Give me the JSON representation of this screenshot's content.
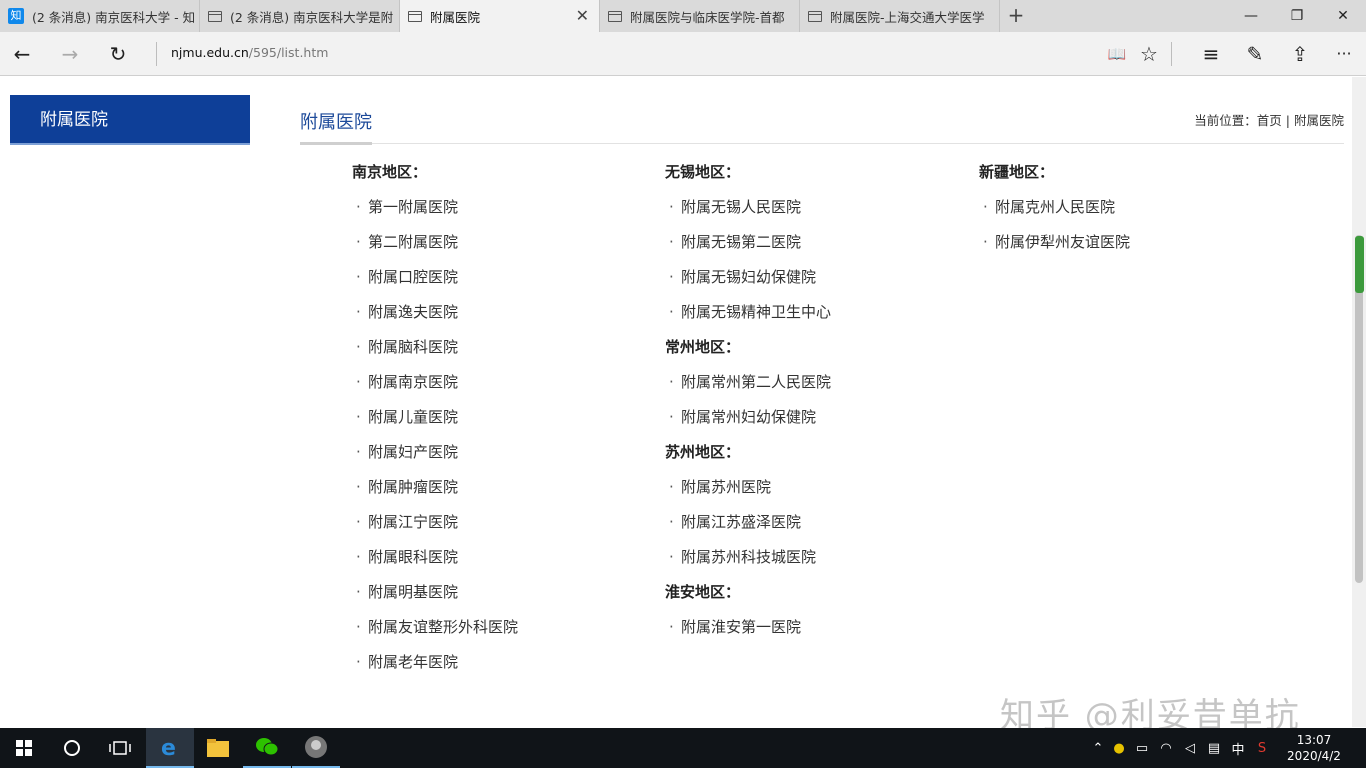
{
  "browser": {
    "tabs": [
      {
        "title": "(2 条消息) 南京医科大学 - 知",
        "icon": "zhihu-icon",
        "active": false
      },
      {
        "title": "(2 条消息) 南京医科大学是附",
        "icon": "page-icon",
        "active": false
      },
      {
        "title": "附属医院",
        "icon": "page-icon",
        "active": true
      },
      {
        "title": "附属医院与临床医学院-首都",
        "icon": "page-icon",
        "active": false
      },
      {
        "title": "附属医院-上海交通大学医学",
        "icon": "page-icon",
        "active": false
      }
    ],
    "zhihu_badge": "知",
    "new_tab": "+",
    "window_controls": {
      "minimize": "—",
      "restore": "❐",
      "close": "✕"
    },
    "tab_close": "✕",
    "address": {
      "host": "njmu.edu.cn",
      "path": "/595/list.htm"
    },
    "nav": {
      "back": "←",
      "forward": "→",
      "refresh": "↻"
    },
    "toolbar_icons": [
      "reading-view-icon",
      "favorite-star-icon",
      "hub-icon",
      "notes-icon",
      "share-icon",
      "more-icon"
    ],
    "toolbar_glyphs": {
      "reading": "📖",
      "star": "☆",
      "hub": "≡",
      "notes": "✎",
      "share": "⇪",
      "more": "···"
    }
  },
  "page": {
    "sidebar_title": "附属医院",
    "title": "附属医院",
    "breadcrumb": {
      "prefix": "当前位置：",
      "home": "首页",
      "sep": " | ",
      "current": "附属医院"
    },
    "bullet": "·",
    "columns": [
      [
        {
          "region": "南京地区：",
          "hospitals": [
            "第一附属医院",
            "第二附属医院",
            "附属口腔医院",
            "附属逸夫医院",
            "附属脑科医院",
            "附属南京医院",
            "附属儿童医院",
            "附属妇产医院",
            "附属肿瘤医院",
            "附属江宁医院",
            "附属眼科医院",
            "附属明基医院",
            "附属友谊整形外科医院",
            "附属老年医院"
          ]
        }
      ],
      [
        {
          "region": "无锡地区：",
          "hospitals": [
            "附属无锡人民医院",
            "附属无锡第二医院",
            "附属无锡妇幼保健院",
            "附属无锡精神卫生中心"
          ]
        },
        {
          "region": "常州地区：",
          "hospitals": [
            "附属常州第二人民医院",
            "附属常州妇幼保健院"
          ]
        },
        {
          "region": "苏州地区：",
          "hospitals": [
            "附属苏州医院",
            "附属江苏盛泽医院",
            "附属苏州科技城医院"
          ]
        },
        {
          "region": "淮安地区：",
          "hospitals": [
            "附属淮安第一医院"
          ]
        }
      ],
      [
        {
          "region": "新疆地区：",
          "hospitals": [
            "附属克州人民医院",
            "附属伊犁州友谊医院"
          ]
        }
      ]
    ]
  },
  "watermark": "知乎 @利妥昔单抗",
  "taskbar": {
    "items": [
      "start-button",
      "search-button",
      "task-view-button",
      "edge-app",
      "file-explorer-app",
      "wechat-app",
      "avatar-app"
    ],
    "tray": {
      "ime": "中",
      "time": "13:07",
      "date": "2020/4/2"
    }
  },
  "colors": {
    "brand_blue": "#0e3f98",
    "title_blue": "#1d4a9a",
    "tabstrip": "#dadada"
  }
}
